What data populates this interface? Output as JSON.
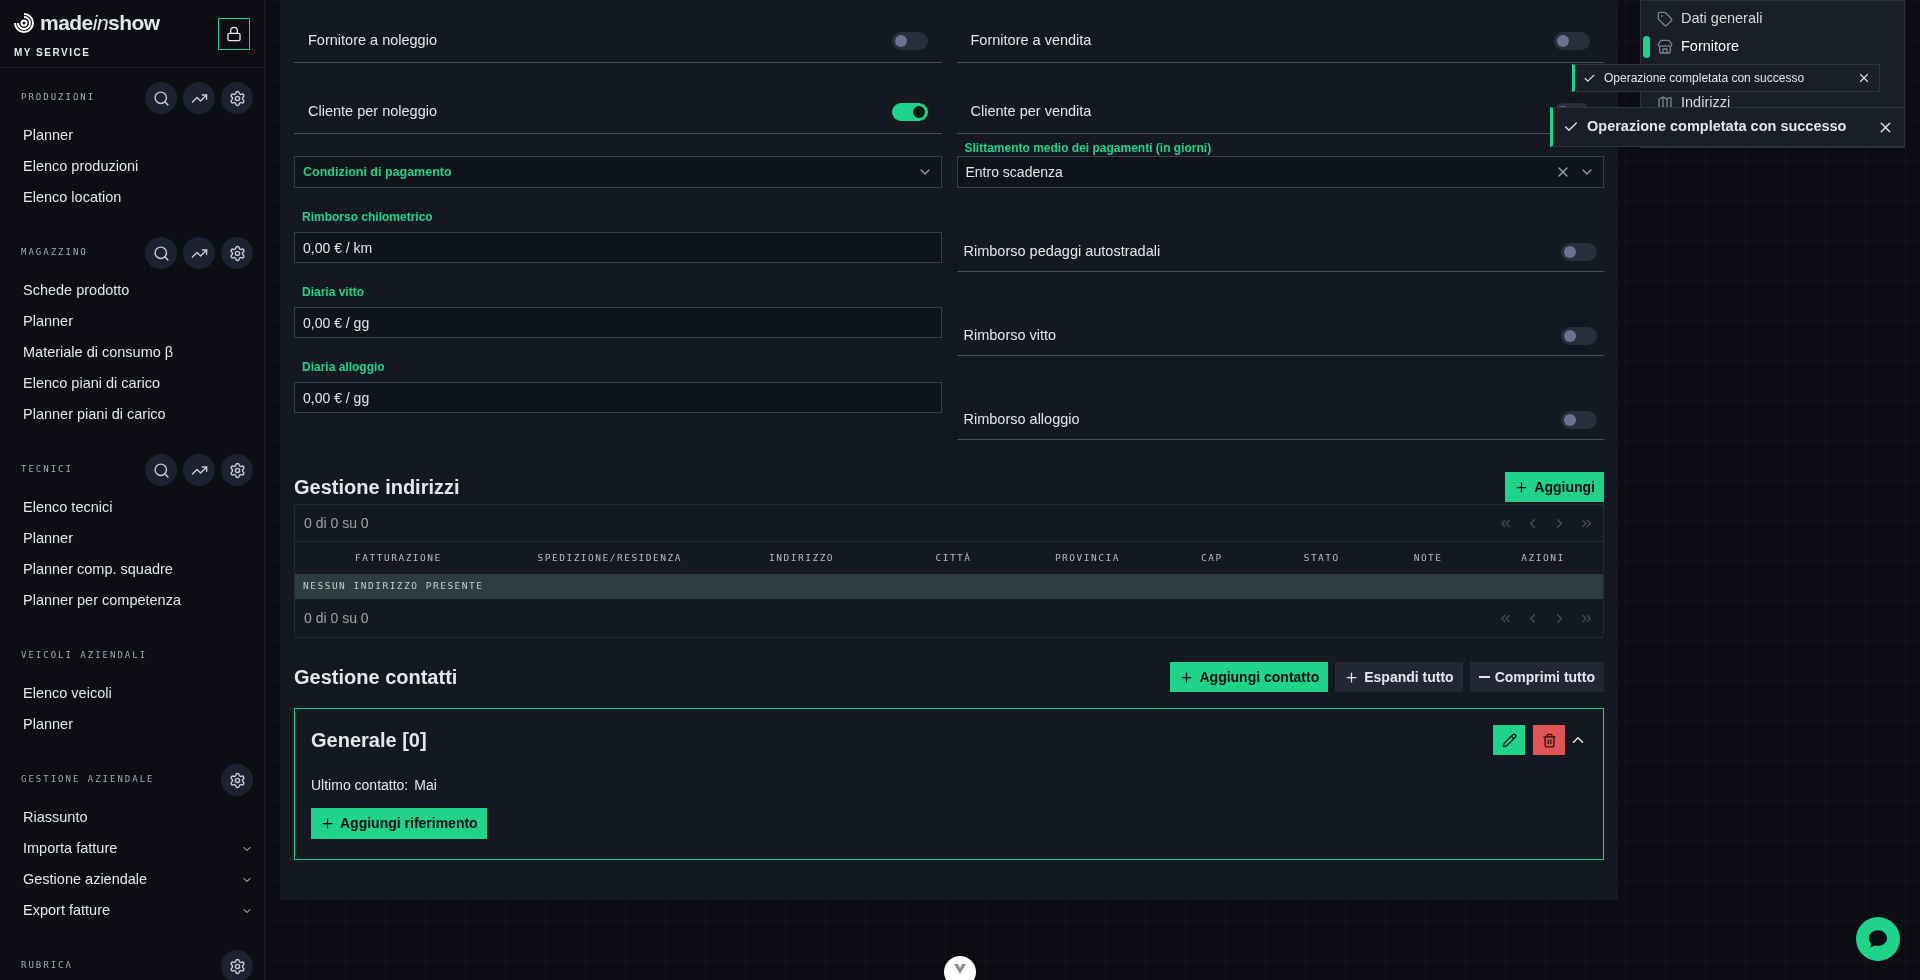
{
  "sidebar": {
    "logo": [
      "made",
      "in",
      "show"
    ],
    "subtitle": "MY SERVICE",
    "sections": [
      {
        "title": "PRODUZIONI",
        "kind": "full",
        "items": [
          {
            "label": "Planner",
            "expandable": false
          },
          {
            "label": "Elenco produzioni",
            "expandable": false
          },
          {
            "label": "Elenco location",
            "expandable": false
          }
        ]
      },
      {
        "title": "MAGAZZINO",
        "kind": "full",
        "items": [
          {
            "label": "Schede prodotto",
            "expandable": false
          },
          {
            "label": "Planner",
            "expandable": false
          },
          {
            "label": "Materiale di consumo β",
            "expandable": false
          },
          {
            "label": "Elenco piani di carico",
            "expandable": false
          },
          {
            "label": "Planner piani di carico",
            "expandable": false
          }
        ]
      },
      {
        "title": "TECNICI",
        "kind": "full",
        "items": [
          {
            "label": "Elenco tecnici",
            "expandable": false
          },
          {
            "label": "Planner",
            "expandable": false
          },
          {
            "label": "Planner comp. squadre",
            "expandable": false
          },
          {
            "label": "Planner per competenza",
            "expandable": false
          }
        ]
      },
      {
        "title": "VEICOLI AZIENDALI",
        "kind": "plain",
        "items": [
          {
            "label": "Elenco veicoli",
            "expandable": false
          },
          {
            "label": "Planner",
            "expandable": false
          }
        ]
      },
      {
        "title": "GESTIONE AZIENDALE",
        "kind": "settings",
        "items": [
          {
            "label": "Riassunto",
            "expandable": false
          },
          {
            "label": "Importa fatture",
            "expandable": true
          },
          {
            "label": "Gestione aziendale",
            "expandable": true
          },
          {
            "label": "Export fatture",
            "expandable": true
          }
        ]
      },
      {
        "title": "RUBRICA",
        "kind": "settings"
      }
    ]
  },
  "switches": [
    {
      "label": "Fornitore a noleggio",
      "on": false
    },
    {
      "label": "Fornitore a vendita",
      "on": false
    },
    {
      "label": "Cliente per noleggio",
      "on": true
    },
    {
      "label": "Cliente per vendita",
      "on": false
    }
  ],
  "fields_left": [
    {
      "kind": "select",
      "placeholder": "Condizioni di pagamento"
    },
    {
      "kind": "input",
      "label": "Rimborso chilometrico",
      "value": "0,00 € / km"
    },
    {
      "kind": "input",
      "label": "Diaria vitto",
      "value": "0,00 € / gg"
    },
    {
      "kind": "input",
      "label": "Diaria alloggio",
      "value": "0,00 € / gg"
    }
  ],
  "fields_right": [
    {
      "kind": "select",
      "label": "Slittamento medio dei pagamenti (in giorni)",
      "value": "Entro scadenza"
    },
    {
      "kind": "toggle",
      "label": "Rimborso pedaggi autostradali",
      "on": false
    },
    {
      "kind": "toggle",
      "label": "Rimborso vitto",
      "on": false
    },
    {
      "kind": "toggle",
      "label": "Rimborso alloggio",
      "on": false
    }
  ],
  "addresses": {
    "title": "Gestione indirizzi",
    "add_button": "Aggiungi",
    "count_top": "0 di 0 su 0",
    "count_bottom": "0 di 0 su 0",
    "columns": [
      "FATTURAZIONE",
      "SPEDIZIONE/RESIDENZA",
      "INDIRIZZO",
      "CITTÀ",
      "PROVINCIA",
      "CAP",
      "STATO",
      "NOTE",
      "AZIONI"
    ],
    "empty": "NESSUN INDIRIZZO PRESENTE"
  },
  "contacts": {
    "title": "Gestione contatti",
    "buttons": [
      {
        "kind": "primary",
        "label": "Aggiungi contatto"
      },
      {
        "kind": "expand",
        "label": "Espandi tutto"
      },
      {
        "kind": "collapse",
        "label": "Comprimi tutto"
      }
    ],
    "group": {
      "title": "Generale [0]",
      "expanded": true,
      "last_label": "Ultimo contatto:",
      "last_value": "Mai",
      "add_ref": "Aggiungi riferimento"
    }
  },
  "nav": [
    {
      "label": "Dati generali",
      "selected": false
    },
    {
      "label": "Fornitore",
      "selected": true
    },
    {
      "label": "Indirizzi",
      "selected": false
    }
  ],
  "toasts": [
    "Operazione completata con successo",
    "Operazione completata con successo"
  ]
}
